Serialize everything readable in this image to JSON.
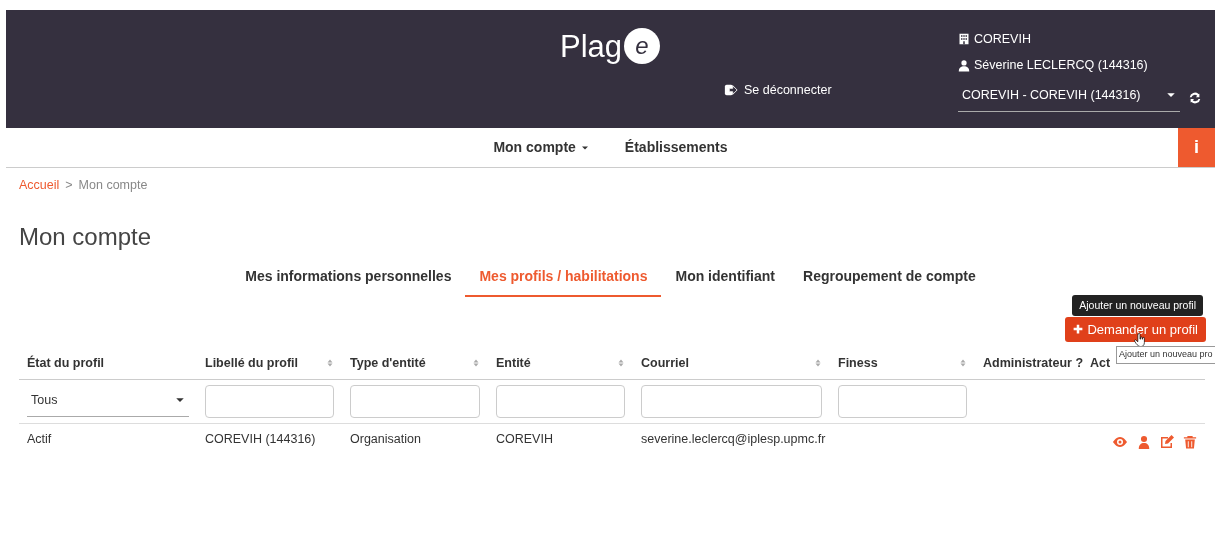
{
  "header": {
    "logo_text": "Plag",
    "logo_badge": "e",
    "logout": "Se déconnecter",
    "organization": "COREVIH",
    "user": "Séverine LECLERCQ (144316)",
    "account_select": "COREVIH - COREVIH (144316)"
  },
  "nav": {
    "items": [
      {
        "label": "Mon compte",
        "dropdown": true
      },
      {
        "label": "Établissements",
        "dropdown": false
      }
    ],
    "info_button": "i"
  },
  "breadcrumb": {
    "items": [
      {
        "label": "Accueil",
        "link": true
      },
      {
        "label": "Mon compte",
        "link": false
      }
    ],
    "separator": ">"
  },
  "page_title": "Mon compte",
  "tabs": [
    {
      "label": "Mes informations personnelles",
      "selected": false
    },
    {
      "label": "Mes profils / habilitations",
      "selected": true
    },
    {
      "label": "Mon identifiant",
      "selected": false
    },
    {
      "label": "Regroupement de compte",
      "selected": false
    }
  ],
  "request_button": {
    "label": "Demander un profil",
    "tooltip": "Ajouter un nouveau profil"
  },
  "table": {
    "columns": [
      {
        "label": "État du profil",
        "sortable": false,
        "kind": "select"
      },
      {
        "label": "Libellé du profil",
        "sortable": true,
        "kind": "text"
      },
      {
        "label": "Type d'entité",
        "sortable": true,
        "kind": "text"
      },
      {
        "label": "Entité",
        "sortable": true,
        "kind": "text"
      },
      {
        "label": "Courriel",
        "sortable": true,
        "kind": "text"
      },
      {
        "label": "Finess",
        "sortable": true,
        "kind": "text"
      },
      {
        "label": "Administrateur ?",
        "sortable": false,
        "kind": "none"
      },
      {
        "label": "Act",
        "sortable": false,
        "kind": "none"
      }
    ],
    "filter_select_value": "Tous",
    "rows": [
      {
        "cells": [
          "Actif",
          "COREVIH (144316)",
          "Organisation",
          "COREVIH",
          "severine.leclercq@iplesp.upmc.fr",
          ""
        ]
      }
    ]
  },
  "hover_tooltip": "Ajouter un nouveau pro"
}
